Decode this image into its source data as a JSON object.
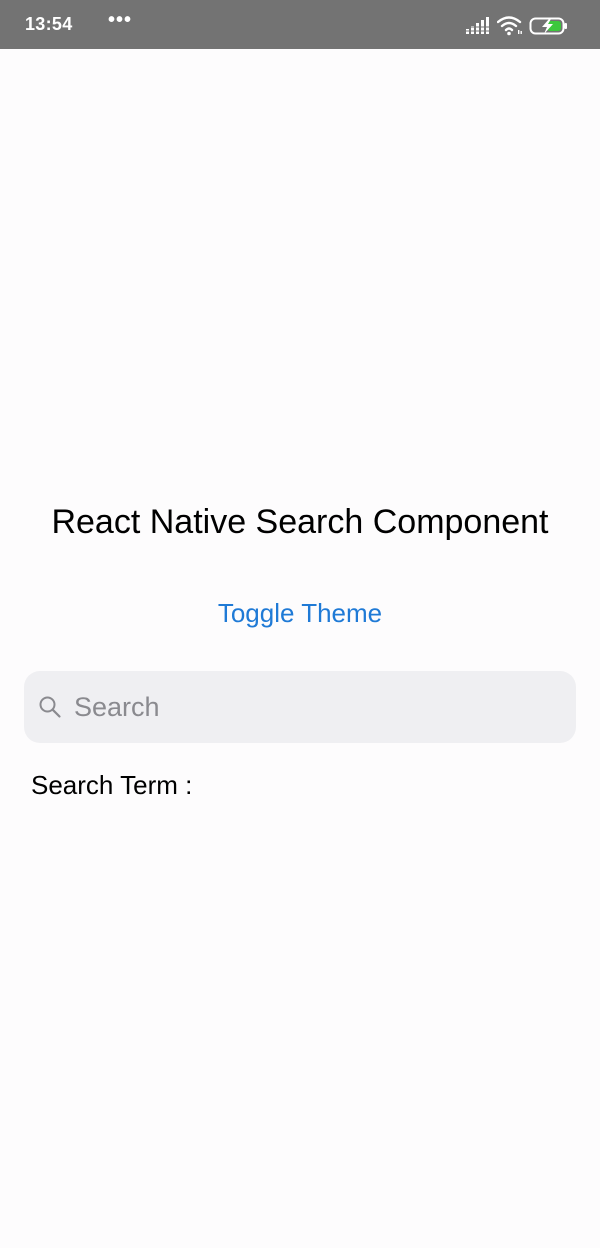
{
  "status_bar": {
    "time": "13:54",
    "more": "•••",
    "icons": [
      "signal-icon",
      "wifi-icon",
      "battery-charging-icon"
    ]
  },
  "app": {
    "title": "React Native Search Component",
    "toggle_label": "Toggle Theme",
    "search": {
      "placeholder": "Search",
      "value": "",
      "icon": "search-icon"
    },
    "search_term_label": "Search Term :"
  },
  "colors": {
    "status_bar": "#737373",
    "background": "#fdfcfd",
    "link": "#1f7ad6",
    "search_background": "#efeff2",
    "battery_charge": "#3cc83c"
  }
}
